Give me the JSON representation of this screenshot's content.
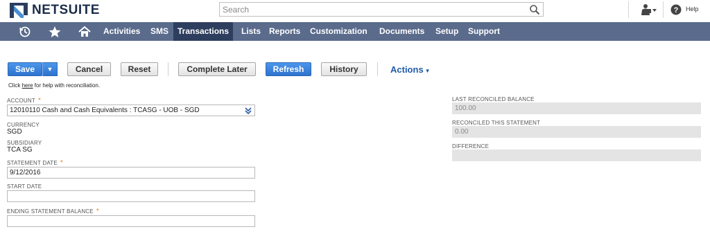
{
  "header": {
    "logo_text": "NETSUITE",
    "search_placeholder": "Search",
    "help_label": "Help",
    "icons": [
      "search-icon",
      "roles-icon",
      "help-icon"
    ]
  },
  "nav": {
    "icons": [
      "recent-records-icon",
      "favorites-star-icon",
      "home-icon"
    ],
    "items": [
      "Activities",
      "SMS",
      "Transactions",
      "Lists",
      "Reports",
      "Customization",
      "Documents",
      "Setup",
      "Support"
    ],
    "active": "Transactions"
  },
  "toolbar": {
    "save": "Save",
    "save_menu_arrow": "▼",
    "cancel": "Cancel",
    "reset": "Reset",
    "complete_later": "Complete Later",
    "refresh": "Refresh",
    "history": "History",
    "actions": "Actions"
  },
  "help_line": {
    "prefix": "Click ",
    "link": "here",
    "suffix": " for help with reconciliation."
  },
  "form": {
    "account_label": "ACCOUNT",
    "account_value": "12010110 Cash and Cash Equivalents : TCASG - UOB - SGD",
    "currency_label": "CURRENCY",
    "currency_value": "SGD",
    "subsidiary_label": "SUBSIDIARY",
    "subsidiary_value": "TCA SG",
    "statement_date_label": "STATEMENT DATE",
    "statement_date_value": "9/12/2016",
    "start_date_label": "START DATE",
    "start_date_value": "",
    "ending_balance_label": "ENDING STATEMENT BALANCE",
    "ending_balance_value": "",
    "required_marker": "*"
  },
  "summary": {
    "last_reconciled_label": "LAST RECONCILED BALANCE",
    "last_reconciled_value": "100.00",
    "reconciled_this_label": "RECONCILED THIS STATEMENT",
    "reconciled_this_value": "0.00",
    "difference_label": "DIFFERENCE",
    "difference_value": ""
  },
  "colors": {
    "nav_bg": "#5a6b8c",
    "nav_active_bg": "#2e3e5e",
    "primary_button": "#3a82dd",
    "actions_link": "#1f5aa6",
    "required_star": "#e08a2b",
    "readonly_field": "#e4e4e4"
  }
}
